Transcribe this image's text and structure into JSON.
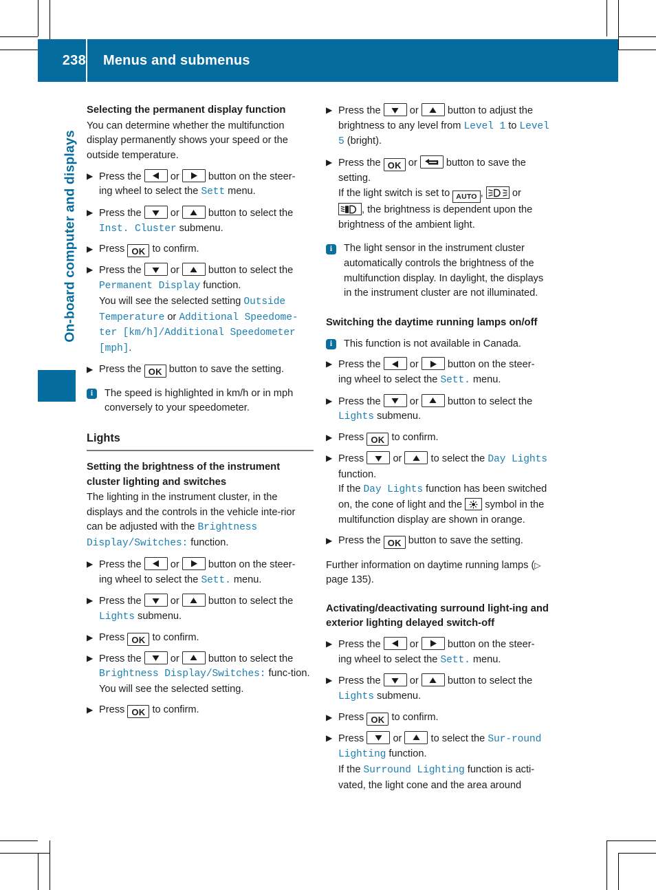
{
  "header": {
    "page_number": "238",
    "title": "Menus and submenus",
    "accent_color": "#046c9e"
  },
  "side": {
    "chapter_title": "On-board computer and displays"
  },
  "icons": {
    "left_button": "left-arrow-button",
    "right_button": "right-arrow-button",
    "down_button": "down-arrow-button",
    "up_button": "up-arrow-button",
    "ok_button": "OK",
    "back_button": "back-arrow-button",
    "auto_symbol": "AUTO",
    "parking_light_symbol": "parking-light-icon",
    "low_beam_symbol": "low-beam-headlight-icon",
    "daytime_running_symbol": "sun-icon",
    "info": "i",
    "step_bullet": "▶",
    "page_ref_triangle": "▷"
  },
  "left_column": {
    "heading_permanent_display": "Selecting the permanent display function",
    "intro": "You can determine whether the multifunction display permanently shows your speed or the outside temperature.",
    "steps": [
      {
        "pre": "Press the",
        "mid": "or",
        "post": "button on the steer-",
        "cont_pre": "ing wheel to select the",
        "cont_menu": "Sett",
        "cont_post": "menu."
      },
      {
        "pre": "Press the",
        "mid": "or",
        "post": "button to select the",
        "cont_menu": "Inst. Cluster",
        "cont_post": "submenu."
      },
      {
        "pre": "Press",
        "post": "to confirm."
      },
      {
        "pre": "Press the",
        "mid": "or",
        "post": "button to select the",
        "cont_menu": "Permanent Display",
        "cont_post": "function.",
        "extra_pre": "You will see the selected setting",
        "extra_menu_1": "Outside Temperature",
        "extra_or": "or",
        "extra_menu_2": "Additional Speedome-ter [km/h]/Additional Speedometer [mph]",
        "extra_end": "."
      },
      {
        "pre": "Press the",
        "post": "button to save the setting."
      }
    ],
    "note_speed": "The speed is highlighted in km/h or in mph conversely to your speedometer.",
    "section_lights": "Lights",
    "heading_brightness": "Setting the brightness of the instrument cluster lighting and switches",
    "brightness_intro_pre": "The lighting in the instrument cluster, in the displays and the controls in the vehicle inte-rior can be adjusted with the",
    "brightness_intro_menu": "Brightness Display/Switches:",
    "brightness_intro_post": "function.",
    "steps2": [
      {
        "pre": "Press the",
        "mid": "or",
        "post": "button on the steer-",
        "cont_pre": "ing wheel to select the",
        "cont_menu": "Sett.",
        "cont_post": "menu."
      },
      {
        "pre": "Press the",
        "mid": "or",
        "post": "button to select the",
        "cont_menu": "Lights",
        "cont_post": "submenu."
      },
      {
        "pre": "Press",
        "post": "to confirm."
      },
      {
        "pre": "Press the",
        "mid": "or",
        "post": "button to select the",
        "cont_menu": "Brightness Display/Switches:",
        "cont_post": "func-tion.",
        "extra_pre": "You will see the selected setting."
      },
      {
        "pre": "Press",
        "post": "to confirm."
      }
    ]
  },
  "right_column": {
    "steps_top": [
      {
        "pre": "Press the",
        "mid": "or",
        "post": "button to adjust the",
        "cont_pre": "brightness to any level from",
        "cont_menu_1": "Level 1",
        "cont_mid": "to",
        "cont_menu_2": "Level 5",
        "cont_post": "(bright)."
      },
      {
        "pre": "Press the",
        "mid": "or",
        "post": "button to save the",
        "cont_pre": "setting.",
        "switch_pre": "If the light switch is set to",
        "switch_mid": ", ",
        "switch_or": "or",
        "switch_post": ", the brightness is dependent upon the brightness of the ambient light."
      }
    ],
    "note_light_sensor_p1": "The light sensor in the instrument cluster automatically controls the brightness of the multifunction display.",
    "note_light_sensor_p2": "In daylight, the displays in the instrument cluster are not illuminated.",
    "heading_daytime": "Switching the daytime running lamps on/off",
    "note_canada": "This function is not available in Canada.",
    "steps_daytime": [
      {
        "pre": "Press the",
        "mid": "or",
        "post": "button on the steer-",
        "cont_pre": "ing wheel to select the",
        "cont_menu": "Sett.",
        "cont_post": "menu."
      },
      {
        "pre": "Press the",
        "mid": "or",
        "post": "button to select the",
        "cont_menu": "Lights",
        "cont_post": "submenu."
      },
      {
        "pre": "Press",
        "post": "to confirm."
      },
      {
        "pre": "Press",
        "mid": "or",
        "post": "to select the",
        "post_menu": "Day Lights",
        "cont_post": "function.",
        "extra_pre": "If the",
        "extra_menu": "Day Lights",
        "extra_mid": "function has been switched on, the cone of light and the",
        "extra_post": "symbol in the multifunction display are shown in orange."
      },
      {
        "pre": "Press the",
        "post": "button to save the setting."
      }
    ],
    "further_info_pre": "Further information on daytime running lamps (",
    "further_info_page": "page 135",
    "further_info_post": ").",
    "heading_surround": "Activating/deactivating surround light-ing and exterior lighting delayed switch-off",
    "steps_surround": [
      {
        "pre": "Press the",
        "mid": "or",
        "post": "button on the steer-",
        "cont_pre": "ing wheel to select the",
        "cont_menu": "Sett.",
        "cont_post": "menu."
      },
      {
        "pre": "Press the",
        "mid": "or",
        "post": "button to select the",
        "cont_menu": "Lights",
        "cont_post": "submenu."
      },
      {
        "pre": "Press",
        "post": "to confirm."
      },
      {
        "pre": "Press",
        "mid": "or",
        "post": "to select the",
        "post_menu": "Sur-round Lighting",
        "cont_post": "function.",
        "extra_pre": "If the",
        "extra_menu": "Surround Lighting",
        "extra_post": "function is acti-vated, the light cone and the area around"
      }
    ]
  }
}
